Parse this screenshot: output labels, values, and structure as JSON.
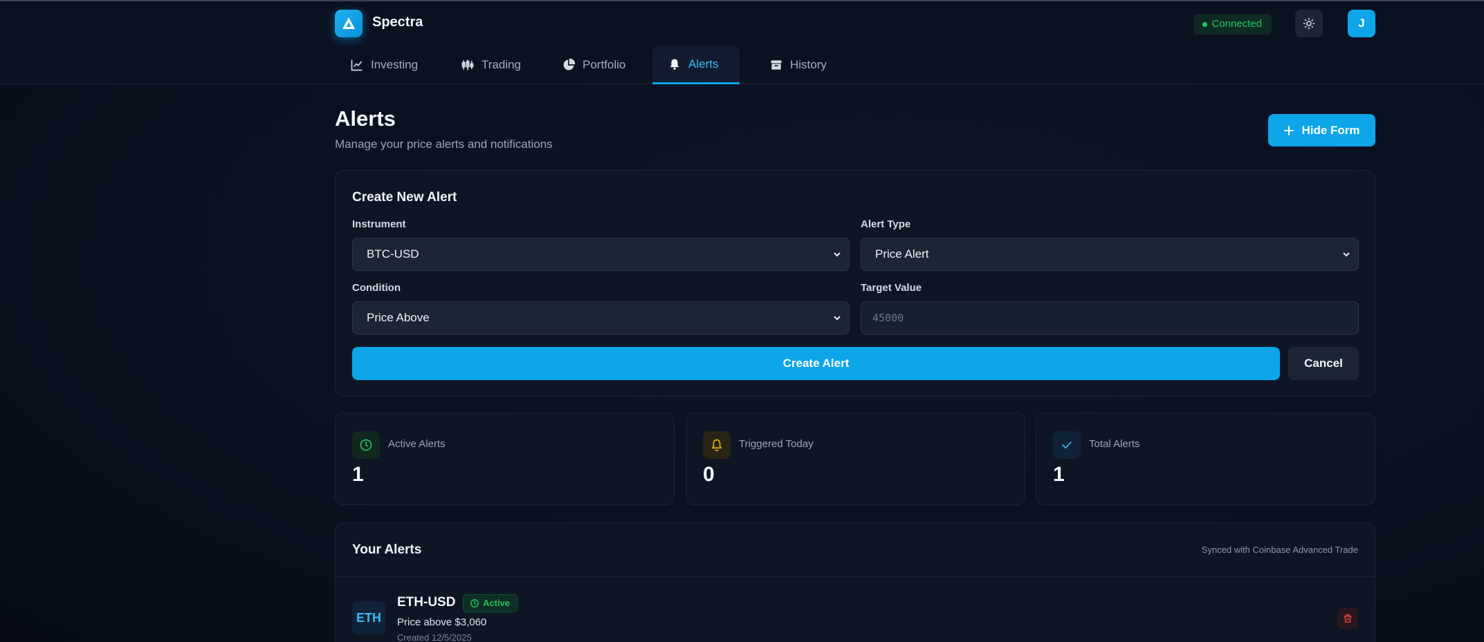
{
  "app": {
    "name": "Spectra",
    "user_initial": "J"
  },
  "status": {
    "connection": "Connected"
  },
  "nav": {
    "tabs": [
      {
        "label": "Investing",
        "icon": "chart-line-icon"
      },
      {
        "label": "Trading",
        "icon": "candlestick-icon"
      },
      {
        "label": "Portfolio",
        "icon": "pie-chart-icon"
      },
      {
        "label": "Alerts",
        "icon": "bell-icon",
        "active": true
      },
      {
        "label": "History",
        "icon": "archive-icon"
      }
    ]
  },
  "page": {
    "title": "Alerts",
    "subtitle": "Manage your price alerts and notifications",
    "hide_form_label": "Hide Form"
  },
  "form": {
    "title": "Create New Alert",
    "instrument_label": "Instrument",
    "instrument_value": "BTC-USD",
    "alert_type_label": "Alert Type",
    "alert_type_value": "Price Alert",
    "condition_label": "Condition",
    "condition_value": "Price Above",
    "target_label": "Target Value",
    "target_placeholder": "45000",
    "create_label": "Create Alert",
    "cancel_label": "Cancel"
  },
  "stats": [
    {
      "label": "Active Alerts",
      "value": "1",
      "icon": "clock-icon",
      "color": "#22c55e"
    },
    {
      "label": "Triggered Today",
      "value": "0",
      "icon": "bell-icon",
      "color": "#eab308"
    },
    {
      "label": "Total Alerts",
      "value": "1",
      "icon": "check-icon",
      "color": "#38bdf8"
    }
  ],
  "alerts": {
    "title": "Your Alerts",
    "sync_note": "Synced with Coinbase Advanced Trade",
    "items": [
      {
        "badge": "ETH",
        "symbol": "ETH-USD",
        "status": "Active",
        "description": "Price above $3,060",
        "created": "Created 12/5/2025"
      }
    ]
  },
  "colors": {
    "accent": "#0ea5e9",
    "success": "#22c55e",
    "warning": "#eab308",
    "danger": "#ef4444"
  }
}
